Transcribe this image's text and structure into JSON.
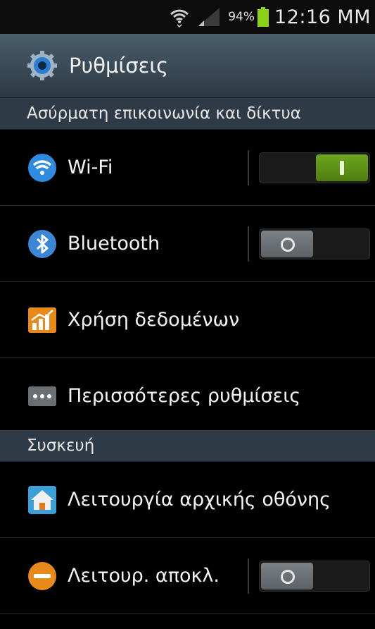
{
  "status_bar": {
    "battery_percent": "94%",
    "time": "12:16 MM",
    "icons": [
      "wifi-icon",
      "signal-icon",
      "battery-icon"
    ]
  },
  "header": {
    "title": "Ρυθμίσεις",
    "icon": "settings-gear-icon"
  },
  "sections": [
    {
      "title": "Ασύρματη επικοινωνία και δίκτυα",
      "items": [
        {
          "label": "Wi-Fi",
          "icon": "wifi-icon",
          "toggle": "on"
        },
        {
          "label": "Bluetooth",
          "icon": "bluetooth-icon",
          "toggle": "off"
        },
        {
          "label": "Χρήση δεδομένων",
          "icon": "data-usage-icon"
        },
        {
          "label": "Περισσότερες ρυθμίσεις",
          "icon": "more-icon"
        }
      ]
    },
    {
      "title": "Συσκευή",
      "items": [
        {
          "label": "Λειτουργία αρχικής οθόνης",
          "icon": "home-screen-icon"
        },
        {
          "label": "Λειτουρ. αποκλ.",
          "icon": "blocking-mode-icon",
          "toggle": "off"
        }
      ]
    }
  ],
  "colors": {
    "toggle_on": "#5e9318",
    "toggle_off": "#6b7075",
    "header_bg": "#2e3b46",
    "wifi_icon_blue": "#2f8be0"
  }
}
